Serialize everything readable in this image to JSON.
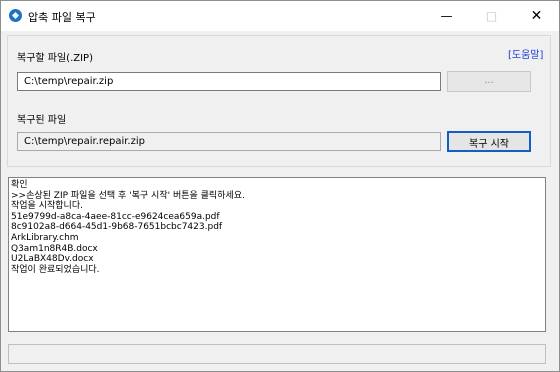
{
  "window": {
    "title": "압축 파일 복구",
    "icon": "app-repair-icon",
    "controls": {
      "minimize": "—",
      "maximize": "□",
      "close": "✕"
    }
  },
  "form": {
    "source_label": "복구할 파일(.ZIP)",
    "help_link": "[도움말]",
    "source_value": "C:\\temp\\repair.zip",
    "browse_label": "...",
    "output_label": "복구된 파일",
    "output_value": "C:\\temp\\repair.repair.zip",
    "start_label": "복구 시작"
  },
  "log": {
    "lines": [
      "확인",
      ">>손상된 ZIP 파일을 선택 후 '복구 시작' 버튼을 클릭하세요.",
      "작업을 시작합니다.",
      "51e9799d-a8ca-4aee-81cc-e9624cea659a.pdf",
      "8c9102a8-d664-45d1-9b68-7651bcbc7423.pdf",
      "ArkLibrary.chm",
      "Q3am1n8R4B.docx",
      "U2LaBX48Dv.docx",
      "작업이 완료되었습니다."
    ]
  },
  "status": {
    "text": ""
  },
  "colors": {
    "accent": "#0f5fc5",
    "link": "#1a3fd6",
    "app_icon": "#1a73c9"
  }
}
